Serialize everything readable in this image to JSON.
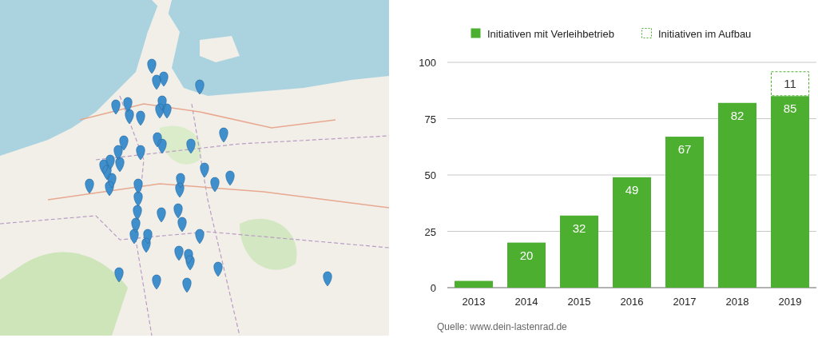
{
  "chart": {
    "chart_data": {
      "type": "bar",
      "categories": [
        "2013",
        "2014",
        "2015",
        "2016",
        "2017",
        "2018",
        "2019"
      ],
      "series": [
        {
          "name": "Initiativen mit Verleihbetrieb",
          "color": "#4caf2f",
          "values": [
            3,
            20,
            32,
            49,
            67,
            82,
            85
          ]
        },
        {
          "name": "Initiativen im Aufbau",
          "color": "#4caf2f",
          "values": [
            null,
            null,
            null,
            null,
            null,
            null,
            11
          ]
        }
      ],
      "stacked": true,
      "ylim": [
        0,
        100
      ],
      "yticks": [
        0,
        25,
        50,
        75,
        100
      ],
      "grid": true,
      "legend": true,
      "value_labels": [
        [
          null,
          "20",
          "32",
          "49",
          "67",
          "82",
          "85"
        ],
        [
          null,
          null,
          null,
          null,
          null,
          null,
          "11"
        ]
      ]
    },
    "source": "Quelle: www.dein-lastenrad.de"
  }
}
